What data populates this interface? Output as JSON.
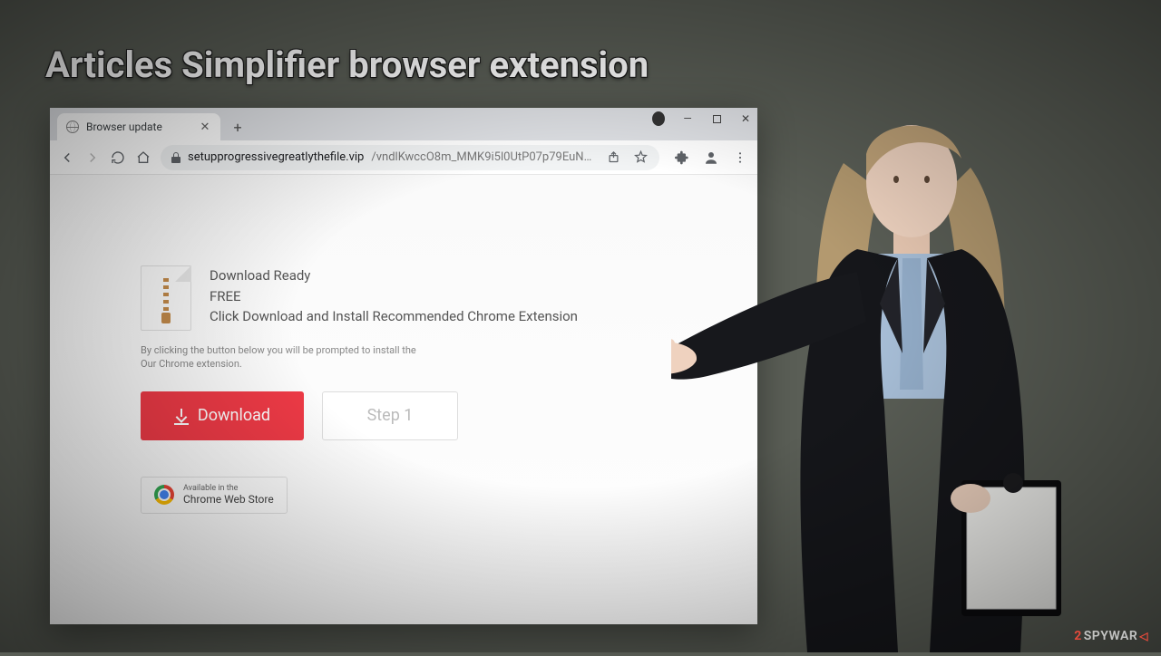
{
  "heading": "Articles Simplifier browser extension",
  "browser": {
    "tab_title": "Browser update",
    "url_host": "setupprogressivegreatlythefile.vip",
    "url_path": "/vndlKwccO8m_MMK9i5l0UtP07p79EuN7dxh9cIVc_00..."
  },
  "page": {
    "title": "Download Ready",
    "subtitle": "FREE",
    "instruction": "Click Download and Install Recommended Chrome Extension",
    "disclaimer_line1": "By clicking the button below you will be prompted to install the",
    "disclaimer_line2": "Our Chrome extension.",
    "download_label": "Download",
    "step_label": "Step 1",
    "store_line1": "Available in the",
    "store_line2": "Chrome Web Store"
  },
  "watermark": {
    "prefix": "2",
    "text": "SPYWAR"
  }
}
